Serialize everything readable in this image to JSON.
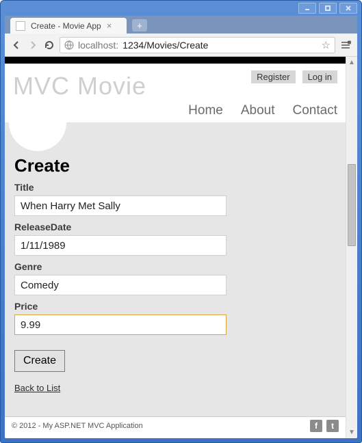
{
  "window": {
    "tab_title": "Create - Movie App"
  },
  "address": {
    "host": "localhost:",
    "port_path": "1234/Movies/Create"
  },
  "header": {
    "brand": "MVC Movie",
    "auth": {
      "register": "Register",
      "login": "Log in"
    },
    "nav": {
      "home": "Home",
      "about": "About",
      "contact": "Contact"
    }
  },
  "page": {
    "title": "Create",
    "fields": {
      "title": {
        "label": "Title",
        "value": "When Harry Met Sally"
      },
      "releaseDate": {
        "label": "ReleaseDate",
        "value": "1/11/1989"
      },
      "genre": {
        "label": "Genre",
        "value": "Comedy"
      },
      "price": {
        "label": "Price",
        "value": "9.99"
      }
    },
    "submit_label": "Create",
    "back_link": "Back to List"
  },
  "footer": {
    "text": "© 2012 - My ASP.NET MVC Application"
  }
}
